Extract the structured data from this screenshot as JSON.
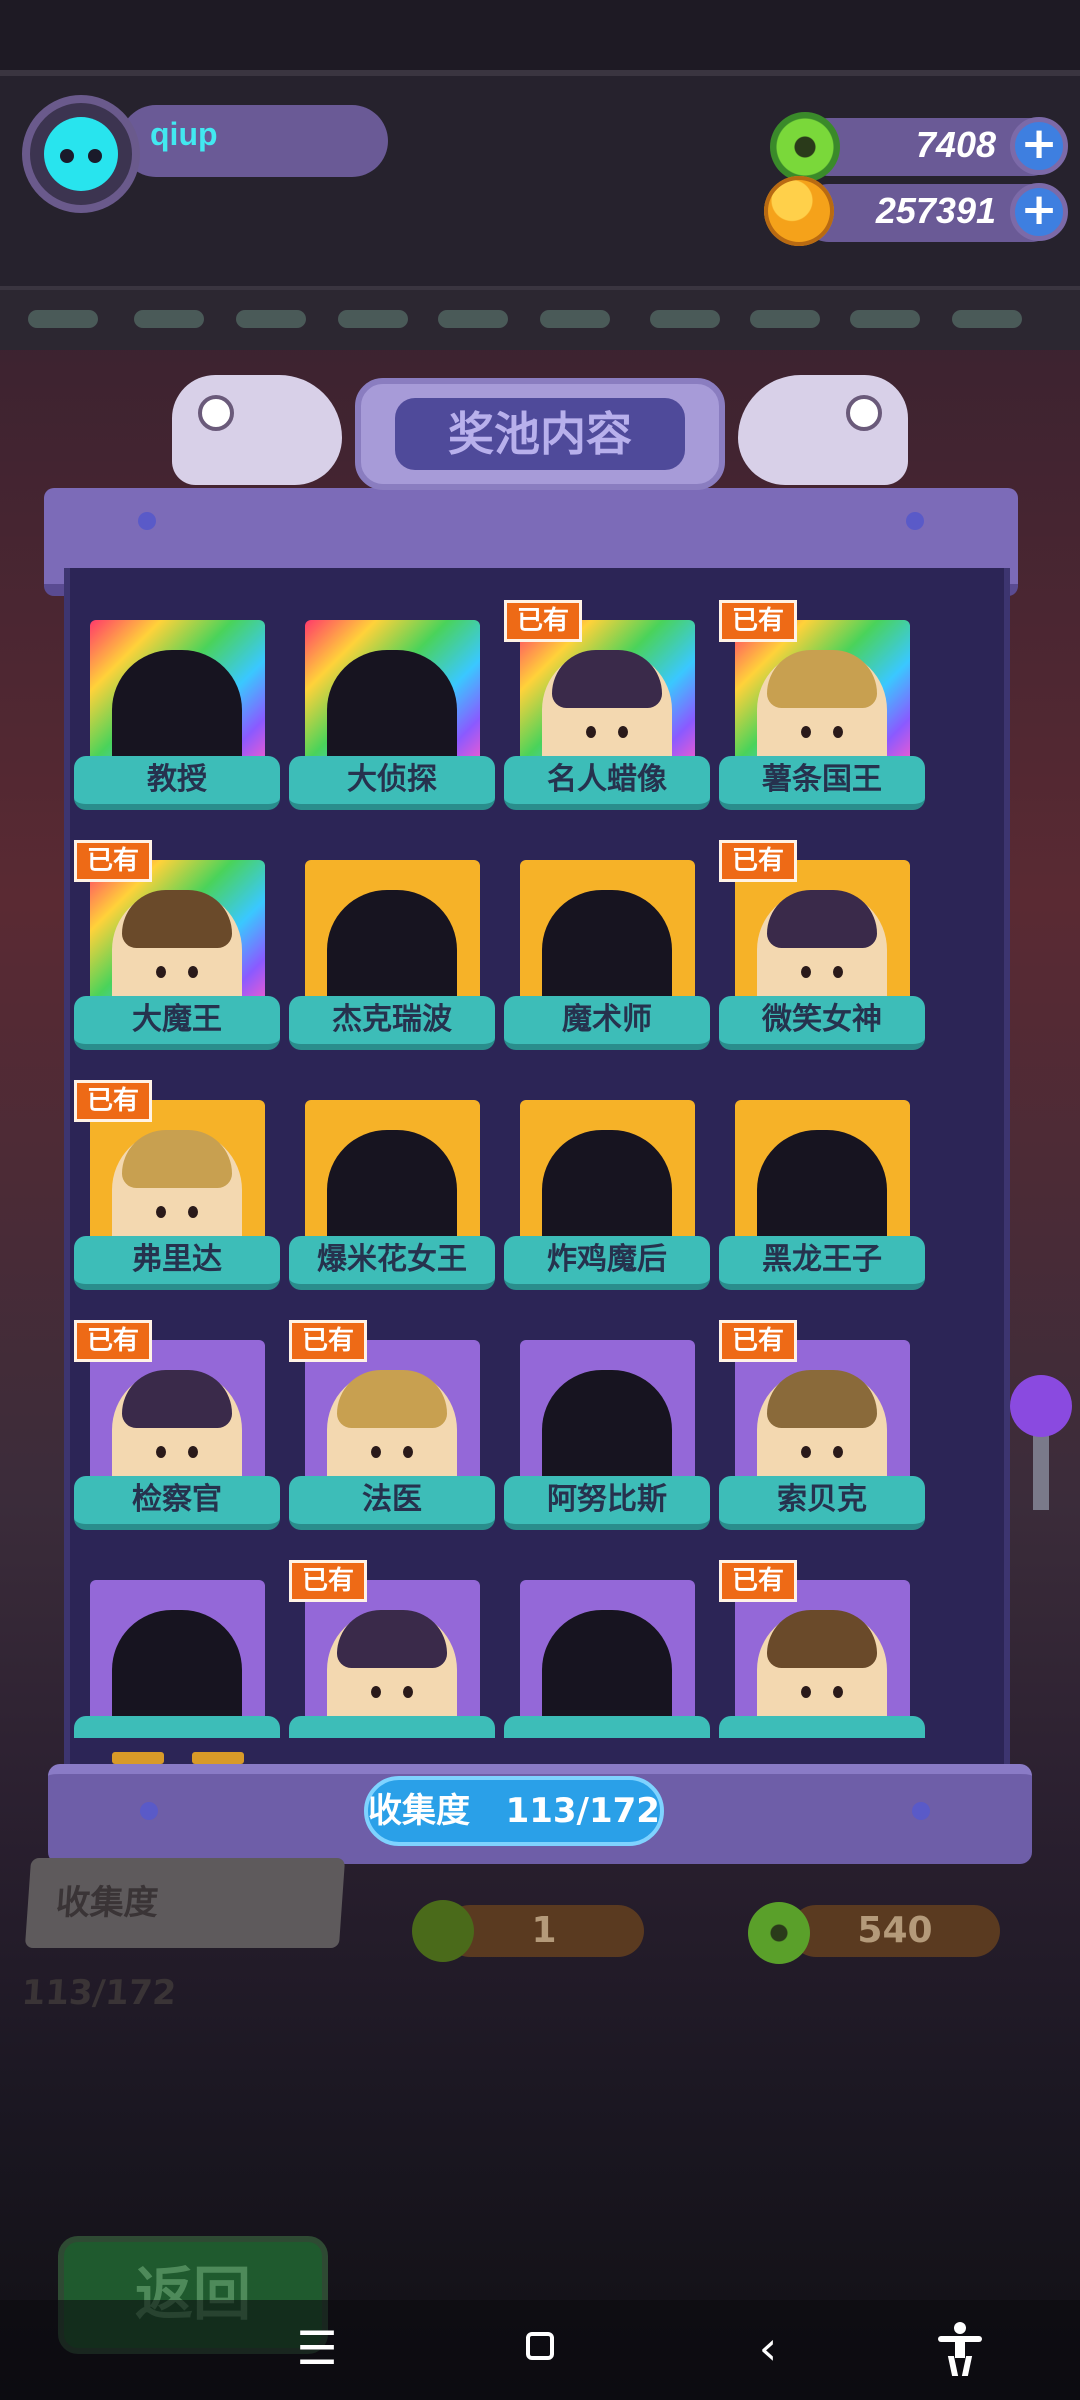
{
  "player": {
    "name": "qiup"
  },
  "currencies": [
    {
      "icon": "donut-coin-icon",
      "value": "7408"
    },
    {
      "icon": "planet-coin-icon",
      "value": "257391"
    }
  ],
  "panel": {
    "title": "奖池内容",
    "owned_badge": "已有",
    "collection_label": "收集度",
    "collection_value": "113/172"
  },
  "characters": [
    {
      "name": "教授",
      "owned": false,
      "frame": "rainbow"
    },
    {
      "name": "大侦探",
      "owned": false,
      "frame": "rainbow"
    },
    {
      "name": "名人蜡像",
      "owned": true,
      "frame": "rainbow"
    },
    {
      "name": "薯条国王",
      "owned": true,
      "frame": "rainbow"
    },
    {
      "name": "大魔王",
      "owned": true,
      "frame": "rainbow"
    },
    {
      "name": "杰克瑞波",
      "owned": false,
      "frame": "gold"
    },
    {
      "name": "魔术师",
      "owned": false,
      "frame": "gold"
    },
    {
      "name": "微笑女神",
      "owned": true,
      "frame": "gold"
    },
    {
      "name": "弗里达",
      "owned": true,
      "frame": "gold"
    },
    {
      "name": "爆米花女王",
      "owned": false,
      "frame": "gold"
    },
    {
      "name": "炸鸡魔后",
      "owned": false,
      "frame": "gold"
    },
    {
      "name": "黑龙王子",
      "owned": false,
      "frame": "gold"
    },
    {
      "name": "检察官",
      "owned": true,
      "frame": "purple"
    },
    {
      "name": "法医",
      "owned": true,
      "frame": "purple"
    },
    {
      "name": "阿努比斯",
      "owned": false,
      "frame": "purple"
    },
    {
      "name": "索贝克",
      "owned": true,
      "frame": "purple"
    },
    {
      "name": "",
      "owned": false,
      "frame": "purple"
    },
    {
      "name": "",
      "owned": true,
      "frame": "purple"
    },
    {
      "name": "",
      "owned": false,
      "frame": "purple"
    },
    {
      "name": "",
      "owned": true,
      "frame": "purple"
    }
  ],
  "background": {
    "collection_label": "收集度",
    "collection_value": "113/172",
    "cost_1": "1",
    "cost_2": "540",
    "back_button": "返回"
  },
  "colors": {
    "owned_badge": "#ee6a16",
    "label_teal": "#3dbdb8",
    "collection_pill": "#2aa0e8",
    "board_purple": "#2c2556"
  }
}
